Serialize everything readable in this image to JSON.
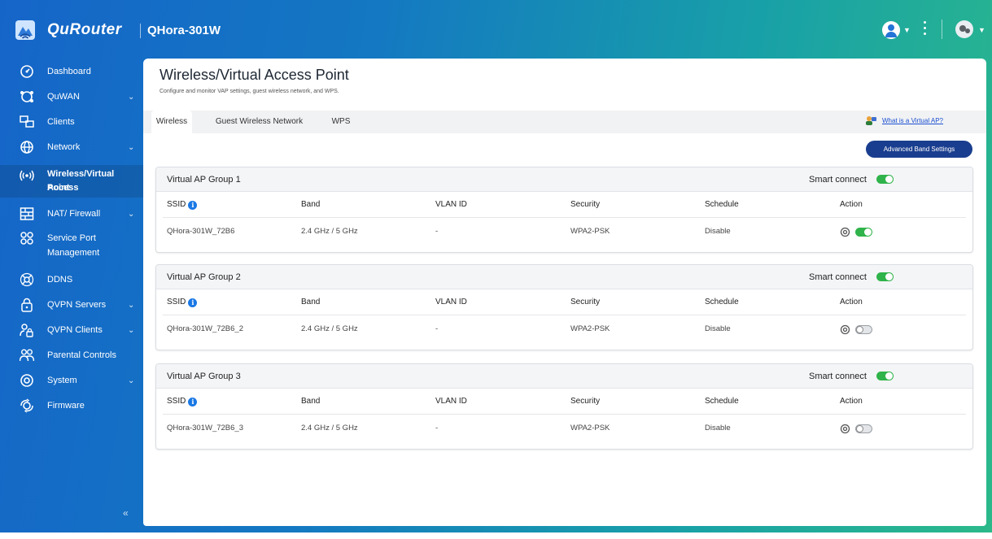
{
  "header": {
    "brand": "QuRouter",
    "model": "QHora-301W"
  },
  "sidebar": {
    "items": [
      {
        "label": "Dashboard",
        "has_chevron": false,
        "icon": "dashboard-icon"
      },
      {
        "label": "QuWAN",
        "has_chevron": true,
        "icon": "quwan-icon"
      },
      {
        "label": "Clients",
        "has_chevron": false,
        "icon": "clients-icon"
      },
      {
        "label": "Network",
        "has_chevron": true,
        "icon": "globe-icon"
      },
      {
        "label_line1": "Wireless/Virtual Access",
        "label_line2": "Point",
        "active": true,
        "icon": "wireless-icon"
      },
      {
        "label": "NAT/ Firewall",
        "has_chevron": true,
        "icon": "firewall-icon"
      },
      {
        "label_line1": "Service Port",
        "label_line2": "Management",
        "icon": "service-port-icon"
      },
      {
        "label": "DDNS",
        "has_chevron": false,
        "icon": "ddns-icon"
      },
      {
        "label": "QVPN Servers",
        "has_chevron": true,
        "icon": "lock-icon"
      },
      {
        "label": "QVPN Clients",
        "has_chevron": true,
        "icon": "vpn-client-icon"
      },
      {
        "label": "Parental Controls",
        "has_chevron": false,
        "icon": "parental-icon"
      },
      {
        "label": "System",
        "has_chevron": true,
        "icon": "gear-icon"
      },
      {
        "label": "Firmware",
        "has_chevron": false,
        "icon": "firmware-icon"
      }
    ]
  },
  "page": {
    "title": "Wireless/Virtual Access Point",
    "description": "Configure and monitor VAP settings, guest wireless network, and WPS.",
    "tabs": [
      "Wireless",
      "Guest Wireless Network",
      "WPS"
    ],
    "active_tab": "Wireless",
    "help_link": "What is a Virtual AP?",
    "advanced_button": "Advanced Band Settings"
  },
  "table_headers": {
    "ssid": "SSID",
    "band": "Band",
    "vlan": "VLAN ID",
    "security": "Security",
    "schedule": "Schedule",
    "action": "Action"
  },
  "groups": [
    {
      "title": "Virtual AP Group 1",
      "smart_connect_label": "Smart connect",
      "smart_connect": true,
      "row": {
        "ssid": "QHora-301W_72B6",
        "band": "2.4 GHz / 5 GHz",
        "vlan": "-",
        "security": "WPA2-PSK",
        "schedule": "Disable",
        "enabled": true
      }
    },
    {
      "title": "Virtual AP Group 2",
      "smart_connect_label": "Smart connect",
      "smart_connect": true,
      "row": {
        "ssid": "QHora-301W_72B6_2",
        "band": "2.4 GHz / 5 GHz",
        "vlan": "-",
        "security": "WPA2-PSK",
        "schedule": "Disable",
        "enabled": false
      }
    },
    {
      "title": "Virtual AP Group 3",
      "smart_connect_label": "Smart connect",
      "smart_connect": true,
      "row": {
        "ssid": "QHora-301W_72B6_3",
        "band": "2.4 GHz / 5 GHz",
        "vlan": "-",
        "security": "WPA2-PSK",
        "schedule": "Disable",
        "enabled": false
      }
    }
  ],
  "colors": {
    "toggle_on": "#2fb34a",
    "primary_button": "#1a3e8f",
    "link": "#1a4fd1",
    "info_badge": "#1978e5"
  }
}
